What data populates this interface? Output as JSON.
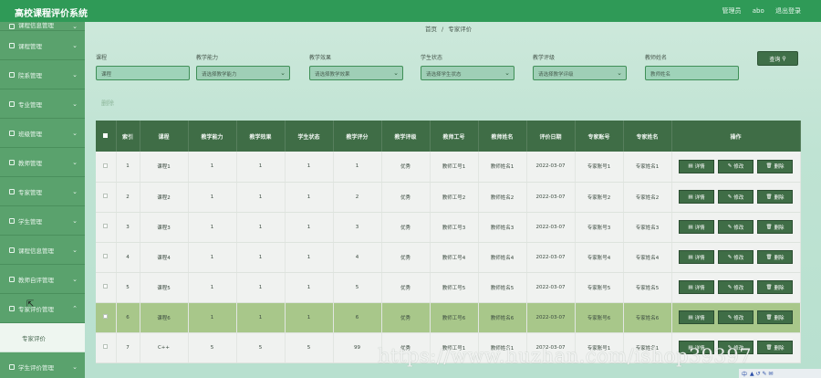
{
  "app": {
    "title": "高校课程评价系统"
  },
  "topbar": {
    "role": "管理员",
    "user": "abo",
    "logout": "退出登录"
  },
  "sidebar": {
    "items": [
      {
        "label": "课程信息管理",
        "icon": "menu-icon",
        "expanded": false
      },
      {
        "label": "课程管理",
        "icon": "menu-icon",
        "expanded": false
      },
      {
        "label": "院系管理",
        "icon": "menu-icon",
        "expanded": false
      },
      {
        "label": "专业管理",
        "icon": "menu-icon",
        "expanded": false
      },
      {
        "label": "班级管理",
        "icon": "menu-icon",
        "expanded": false
      },
      {
        "label": "教师管理",
        "icon": "menu-icon",
        "expanded": false
      },
      {
        "label": "专家管理",
        "icon": "menu-icon",
        "expanded": false
      },
      {
        "label": "学生管理",
        "icon": "menu-icon",
        "expanded": false
      },
      {
        "label": "课程信息管理",
        "icon": "menu-icon",
        "expanded": false
      },
      {
        "label": "教师自评管理",
        "icon": "menu-icon",
        "expanded": false
      },
      {
        "label": "专家评价管理",
        "icon": "menu-icon",
        "expanded": true
      },
      {
        "label": "学生评价管理",
        "icon": "menu-icon",
        "expanded": false
      }
    ],
    "sub_item": "专家评价"
  },
  "breadcrumb": {
    "home": "首页",
    "sep": "/",
    "current": "专家评价"
  },
  "filters": {
    "course": {
      "label": "课程",
      "placeholder": "课程"
    },
    "ability": {
      "label": "教学能力",
      "placeholder": "请选择教学能力"
    },
    "effect": {
      "label": "教学效果",
      "placeholder": "请选择教学效果"
    },
    "status": {
      "label": "学生状态",
      "placeholder": "请选择学生状态"
    },
    "eval": {
      "label": "教学评级",
      "placeholder": "请选择教学评级"
    },
    "teacher": {
      "label": "教师姓名",
      "placeholder": "教师姓名"
    }
  },
  "buttons": {
    "search": "查询",
    "delete": "删除"
  },
  "table": {
    "headers": [
      "",
      "索引",
      "课程",
      "教学能力",
      "教学效果",
      "学生状态",
      "教学评分",
      "教学评级",
      "教师工号",
      "教师姓名",
      "评价日期",
      "专家账号",
      "专家姓名",
      "操作"
    ],
    "rows": [
      [
        "1",
        "课程1",
        "1",
        "1",
        "1",
        "1",
        "优秀",
        "教师工号1",
        "教师姓名1",
        "2022-03-07",
        "专家账号1",
        "专家姓名1"
      ],
      [
        "2",
        "课程2",
        "1",
        "1",
        "1",
        "2",
        "优秀",
        "教师工号2",
        "教师姓名2",
        "2022-03-07",
        "专家账号2",
        "专家姓名2"
      ],
      [
        "3",
        "课程3",
        "1",
        "1",
        "1",
        "3",
        "优秀",
        "教师工号3",
        "教师姓名3",
        "2022-03-07",
        "专家账号3",
        "专家姓名3"
      ],
      [
        "4",
        "课程4",
        "1",
        "1",
        "1",
        "4",
        "优秀",
        "教师工号4",
        "教师姓名4",
        "2022-03-07",
        "专家账号4",
        "专家姓名4"
      ],
      [
        "5",
        "课程5",
        "1",
        "1",
        "1",
        "5",
        "优秀",
        "教师工号5",
        "教师姓名5",
        "2022-03-07",
        "专家账号5",
        "专家姓名5"
      ],
      [
        "6",
        "课程6",
        "1",
        "1",
        "1",
        "6",
        "优秀",
        "教师工号6",
        "教师姓名6",
        "2022-03-07",
        "专家账号6",
        "专家姓名6"
      ],
      [
        "7",
        "C++",
        "5",
        "5",
        "5",
        "99",
        "优秀",
        "教师工号1",
        "教师姓名1",
        "2022-03-07",
        "专家账号1",
        "专家姓名1"
      ]
    ],
    "selected_row": 5,
    "actions": {
      "detail": "详情",
      "edit": "修改",
      "del": "删除"
    }
  },
  "watermark": "https://www.huzhan.com/ishop39397",
  "taskbar": {
    "text": "中",
    "items": "▲ ↺ ✎ ✉"
  },
  "colors": {
    "topbar": "#2f9a57",
    "sidebar": "#58a06b",
    "header": "#3f6d46",
    "selected": "#a8c78a"
  }
}
